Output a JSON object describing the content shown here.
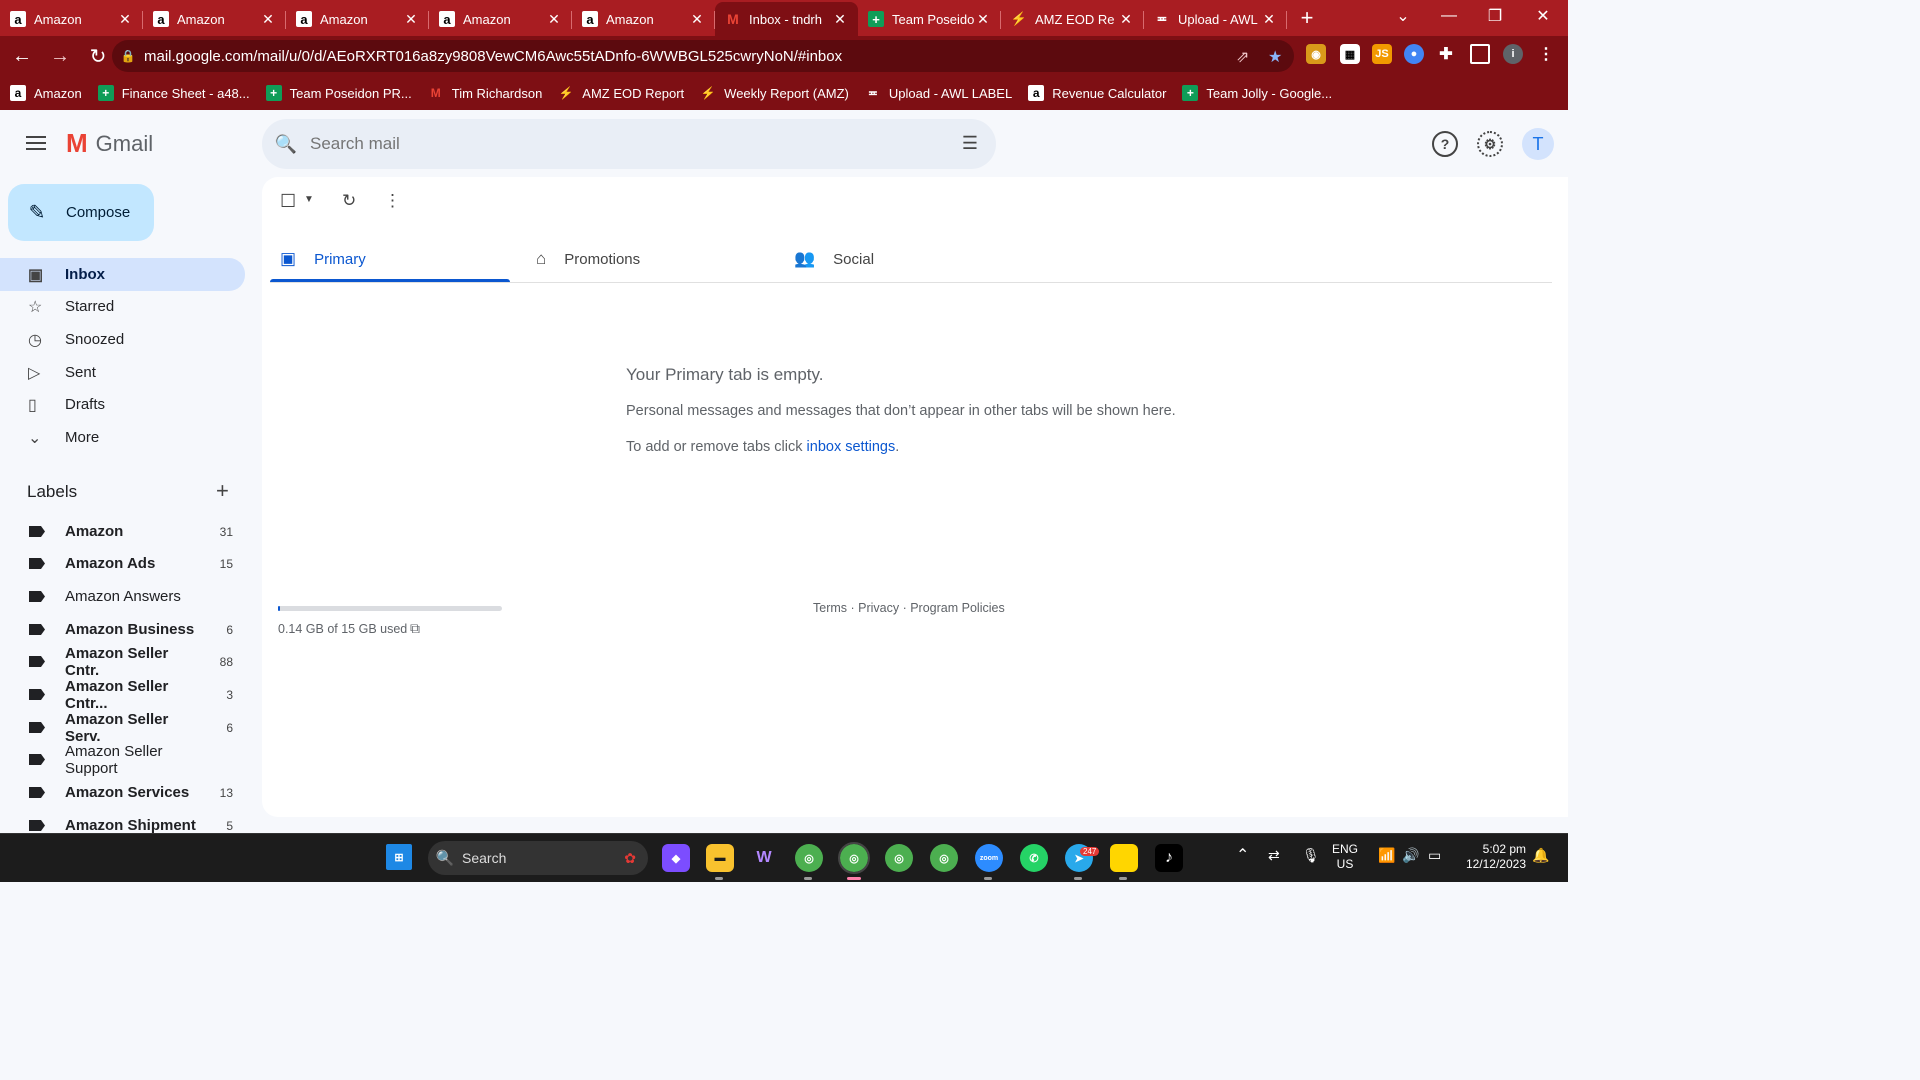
{
  "browser": {
    "tabs": [
      {
        "title": "Amazon",
        "icon": "amazon-icon",
        "active": false
      },
      {
        "title": "Amazon",
        "icon": "amazon-icon",
        "active": false
      },
      {
        "title": "Amazon",
        "icon": "amazon-icon",
        "active": false
      },
      {
        "title": "Amazon",
        "icon": "amazon-icon",
        "active": false
      },
      {
        "title": "Amazon",
        "icon": "amazon-icon",
        "active": false
      },
      {
        "title": "Inbox - tndrh",
        "icon": "gmail-icon",
        "active": true
      },
      {
        "title": "Team Poseido",
        "icon": "sheets-icon",
        "active": false
      },
      {
        "title": "AMZ EOD Re",
        "icon": "slides-icon",
        "active": false
      },
      {
        "title": "Upload - AWL",
        "icon": "upload-icon",
        "active": false
      }
    ],
    "url": "mail.google.com/mail/u/0/d/AEoRXRT016a8zy9808VewCM6Awc55tADnfo-6WWBGL525cwryNoN/#inbox",
    "bookmarks": [
      {
        "label": "Amazon",
        "icon": "amazon-icon"
      },
      {
        "label": "Finance Sheet - a48...",
        "icon": "sheets-icon"
      },
      {
        "label": "Team Poseidon PR...",
        "icon": "sheets-icon"
      },
      {
        "label": "Tim Richardson",
        "icon": "gmail-icon"
      },
      {
        "label": "AMZ EOD Report",
        "icon": "slides-icon"
      },
      {
        "label": "Weekly Report (AMZ)",
        "icon": "slides-icon"
      },
      {
        "label": "Upload - AWL LABEL",
        "icon": "upload-icon"
      },
      {
        "label": "Revenue Calculator",
        "icon": "amazon-icon"
      },
      {
        "label": "Team Jolly - Google...",
        "icon": "sheets-icon"
      }
    ],
    "profile_initial": "i"
  },
  "gmail": {
    "app_name": "Gmail",
    "search_placeholder": "Search mail",
    "avatar_initial": "T",
    "compose_label": "Compose",
    "nav": [
      {
        "label": "Inbox",
        "icon": "inbox-icon",
        "active": true
      },
      {
        "label": "Starred",
        "icon": "star-icon",
        "active": false
      },
      {
        "label": "Snoozed",
        "icon": "clock-icon",
        "active": false
      },
      {
        "label": "Sent",
        "icon": "send-icon",
        "active": false
      },
      {
        "label": "Drafts",
        "icon": "draft-icon",
        "active": false
      },
      {
        "label": "More",
        "icon": "chevron-down-icon",
        "active": false
      }
    ],
    "labels_title": "Labels",
    "labels": [
      {
        "name": "Amazon",
        "count": "31",
        "bold": true
      },
      {
        "name": "Amazon Ads",
        "count": "15",
        "bold": true
      },
      {
        "name": "Amazon Answers",
        "count": "",
        "bold": false
      },
      {
        "name": "Amazon Business",
        "count": "6",
        "bold": true
      },
      {
        "name": "Amazon Seller Cntr.",
        "count": "88",
        "bold": true
      },
      {
        "name": "Amazon Seller Cntr...",
        "count": "3",
        "bold": true
      },
      {
        "name": "Amazon Seller Serv.",
        "count": "6",
        "bold": true
      },
      {
        "name": "Amazon Seller Support",
        "count": "",
        "bold": false
      },
      {
        "name": "Amazon Services",
        "count": "13",
        "bold": true
      },
      {
        "name": "Amazon Shipment",
        "count": "5",
        "bold": true
      }
    ],
    "tabs": [
      {
        "label": "Primary",
        "icon": "inbox-tab-icon",
        "active": true
      },
      {
        "label": "Promotions",
        "icon": "tag-icon",
        "active": false
      },
      {
        "label": "Social",
        "icon": "people-icon",
        "active": false
      }
    ],
    "empty_title": "Your Primary tab is empty.",
    "empty_message": "Personal messages and messages that don’t appear in other tabs will be shown here.",
    "empty_settings_prefix": "To add or remove tabs click ",
    "empty_settings_link": "inbox settings",
    "empty_settings_suffix": ".",
    "storage_text": "0.14 GB of 15 GB used",
    "storage_used_fraction": 0.0093,
    "footer": "Terms · Privacy · Program Policies"
  },
  "taskbar": {
    "search_label": "Search",
    "lang_top": "ENG",
    "lang_bottom": "US",
    "time": "5:02 pm",
    "date": "12/12/2023",
    "telegram_badge": "247"
  },
  "colors": {
    "browser_frame": "#a91d22",
    "browser_toolbar": "#7e0f14",
    "gmail_accent": "#0b57d0",
    "compose_bg": "#c2e7ff",
    "nav_active_bg": "#d3e3fd"
  }
}
